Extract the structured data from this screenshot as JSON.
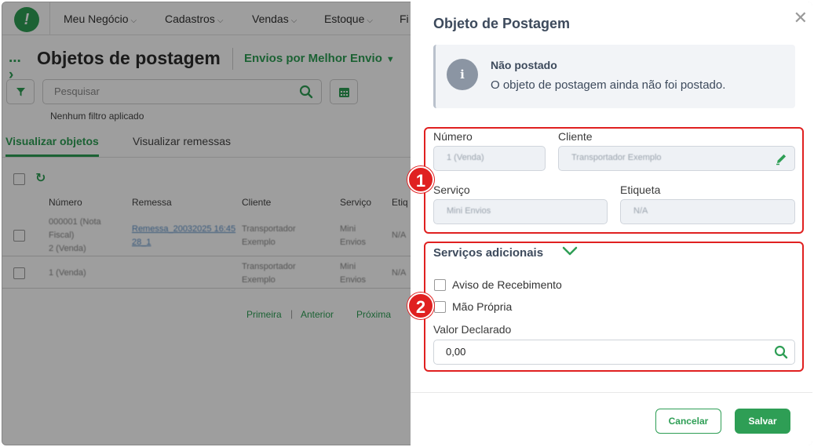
{
  "topbar": {
    "logo": "!",
    "menu": [
      {
        "label": "Meu Negócio"
      },
      {
        "label": "Cadastros"
      },
      {
        "label": "Vendas"
      },
      {
        "label": "Estoque"
      },
      {
        "label": "Fi"
      }
    ]
  },
  "page": {
    "breadcrumb": "...",
    "title": "Objetos de postagem",
    "envios_selector": "Envios por Melhor Envio",
    "search_placeholder": "Pesquisar",
    "no_filter": "Nenhum filtro aplicado",
    "tabs": [
      {
        "label": "Visualizar objetos",
        "active": true
      },
      {
        "label": "Visualizar remessas",
        "active": false
      }
    ],
    "columns": [
      "Número",
      "Remessa",
      "Cliente",
      "Serviço",
      "Etiq"
    ],
    "rows": [
      {
        "numero_1": "000001 (Nota",
        "numero_2": "Fiscal)",
        "numero_3": "2 (Venda)",
        "remessa_1": "Remessa_20032025 16:45",
        "remessa_2": "28_1",
        "cliente_1": "Transportador",
        "cliente_2": "Exemplo",
        "servico_1": "Mini",
        "servico_2": "Envios",
        "etiqueta": "N/A"
      },
      {
        "numero_1": "1 (Venda)",
        "cliente_1": "Transportador",
        "cliente_2": "Exemplo",
        "servico_1": "Mini",
        "servico_2": "Envios",
        "etiqueta": "N/A"
      }
    ],
    "pager": {
      "first": "Primeira",
      "sep": "|",
      "prev": "Anterior",
      "next": "Próxima"
    }
  },
  "panel": {
    "title": "Objeto de Postagem",
    "close": "✕",
    "info": {
      "icon": "i",
      "title": "Não postado",
      "text": "O objeto de postagem ainda não foi postado."
    },
    "fields": {
      "numero_label": "Número",
      "numero_value": "1 (Venda)",
      "cliente_label": "Cliente",
      "cliente_value": "Transportador Exemplo",
      "servico_label": "Serviço",
      "servico_value": "Mini Envios",
      "etiqueta_label": "Etiqueta",
      "etiqueta_value": "N/A"
    },
    "badges": [
      "1",
      "2"
    ],
    "servicos": {
      "title": "Serviços adicionais",
      "aviso": "Aviso de Recebimento",
      "mao_propria": "Mão Própria",
      "valor_label": "Valor Declarado",
      "valor_value": "0,00"
    },
    "buttons": {
      "cancel": "Cancelar",
      "save": "Salvar"
    }
  },
  "colors": {
    "brand": "#2e9e55",
    "highlight": "#e02020"
  }
}
